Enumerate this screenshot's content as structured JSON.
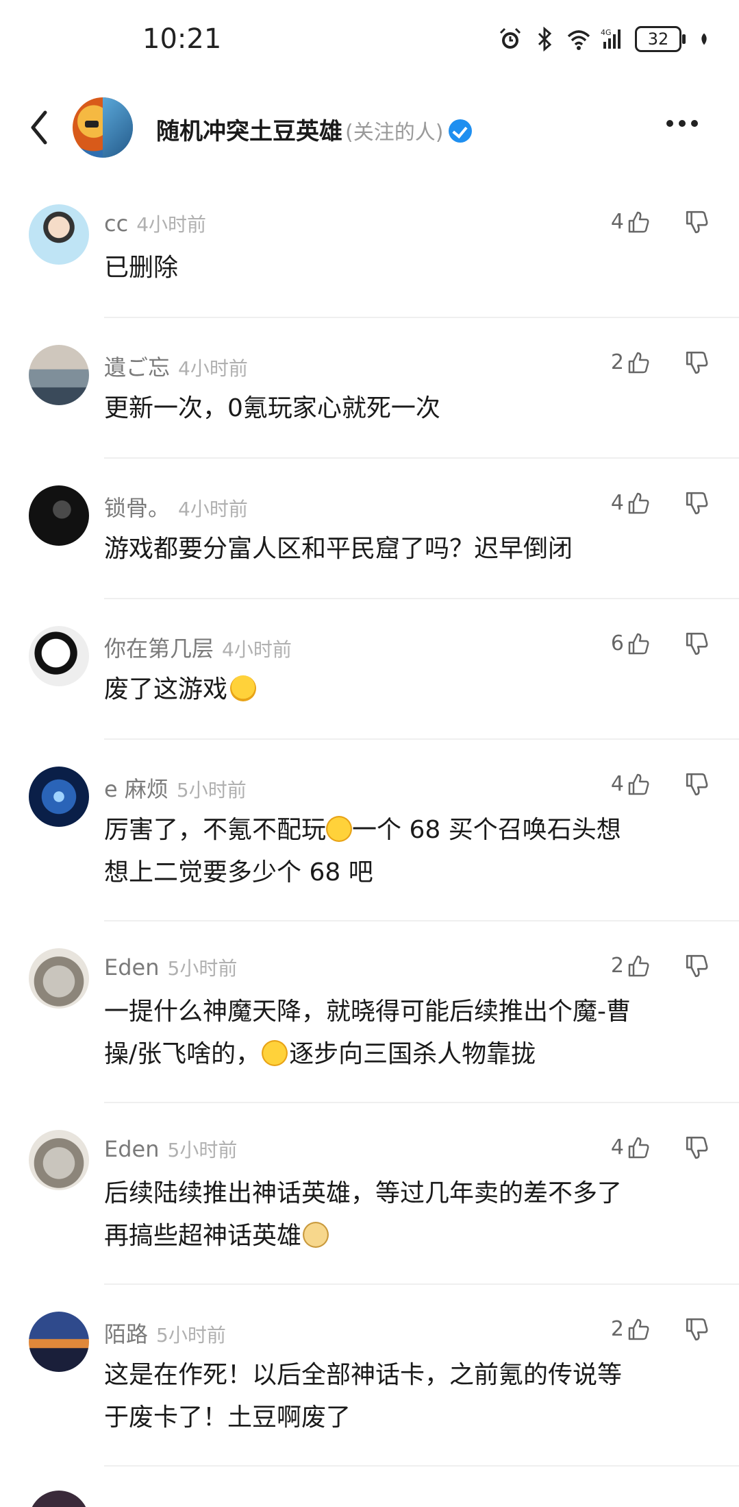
{
  "status": {
    "time": "10:21",
    "battery": "32",
    "network": "4G"
  },
  "header": {
    "title": "随机冲突土豆英雄",
    "subtitle": "(关注的人)"
  },
  "comments": [
    {
      "name": "cc",
      "time": "4小时前",
      "text": "已删除",
      "likes": "4"
    },
    {
      "name": "遺ご忘",
      "time": "4小时前",
      "text": "更新一次，0氪玩家心就死一次",
      "likes": "2"
    },
    {
      "name": "锁骨。",
      "time": "4小时前",
      "text": "游戏都要分富人区和平民窟了吗？迟早倒闭",
      "likes": "4"
    },
    {
      "name": "你在第几层",
      "time": "4小时前",
      "text": "废了这游戏",
      "likes": "6"
    },
    {
      "name": "e 麻烦",
      "time": "5小时前",
      "text_a": "厉害了，不氪不配玩",
      "text_b": "一个 68 买个召唤石头想",
      "text_c": "想上二觉要多少个 68 吧",
      "likes": "4"
    },
    {
      "name": "Eden",
      "time": "5小时前",
      "text_a": "一提什么神魔天降，就晓得可能后续推出个魔-曹",
      "text_b": "操/张飞啥的，",
      "text_c": "逐步向三国杀人物靠拢",
      "likes": "2"
    },
    {
      "name": "Eden",
      "time": "5小时前",
      "text_a": "后续陆续推出神话英雄，等过几年卖的差不多了",
      "text_b": "再搞些超神话英雄",
      "likes": "4"
    },
    {
      "name": "陌路",
      "time": "5小时前",
      "text_a": "这是在作死！以后全部神话卡，之前氪的传说等",
      "text_b": "于废卡了！土豆啊废了",
      "likes": "2"
    }
  ],
  "icons": {
    "like": "thumbs-up-icon",
    "dislike": "thumbs-down-icon",
    "back": "chevron-left-icon",
    "more": "more-dots-icon"
  },
  "colors": {
    "verified": "#1f8ff0"
  }
}
